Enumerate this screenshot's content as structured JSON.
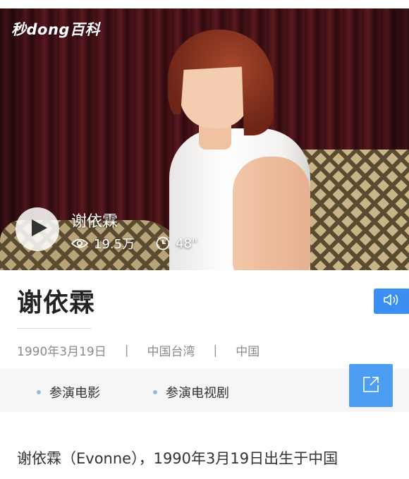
{
  "video": {
    "logo": "秒dong百科",
    "title": "谢依霖",
    "views": "19.5万",
    "duration": "48\""
  },
  "person": {
    "name": "谢依霖",
    "birth_date": "1990年3月19日",
    "birthplace": "中国台湾",
    "nationality": "中国"
  },
  "links": [
    {
      "label": "参演电影"
    },
    {
      "label": "参演电视剧"
    }
  ],
  "intro": "谢依霖（Evonne），1990年3月19日出生于中国",
  "colors": {
    "accent": "#3b8ff0",
    "bullet": "#8fbde8",
    "meta_text": "#8a8a8a"
  },
  "icons": {
    "play": "play-icon",
    "views": "eye-icon",
    "duration": "clock-icon",
    "audio": "speaker-icon",
    "share": "share-icon"
  }
}
